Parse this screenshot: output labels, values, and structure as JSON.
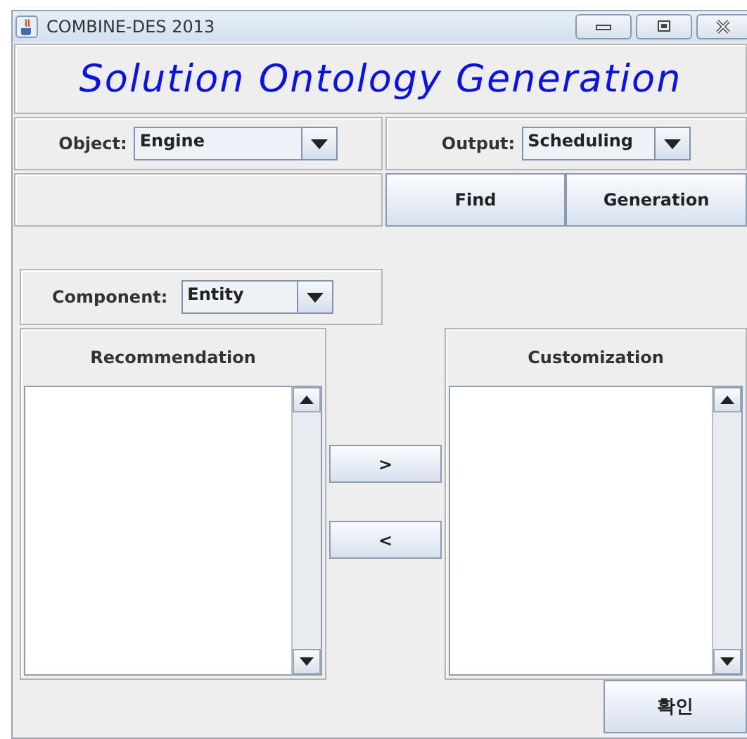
{
  "window": {
    "title": "COMBINE-DES 2013"
  },
  "heading": "Solution Ontology Generation",
  "object": {
    "label": "Object:",
    "value": "Engine"
  },
  "output": {
    "label": "Output:",
    "value": "Scheduling"
  },
  "action_buttons": [
    "Find",
    "Generation"
  ],
  "component": {
    "label": "Component:",
    "value": "Entity"
  },
  "recommendation": {
    "title": "Recommendation"
  },
  "customization": {
    "title": "Customization"
  },
  "move_buttons": [
    ">",
    "<"
  ],
  "confirm_button": "확인"
}
